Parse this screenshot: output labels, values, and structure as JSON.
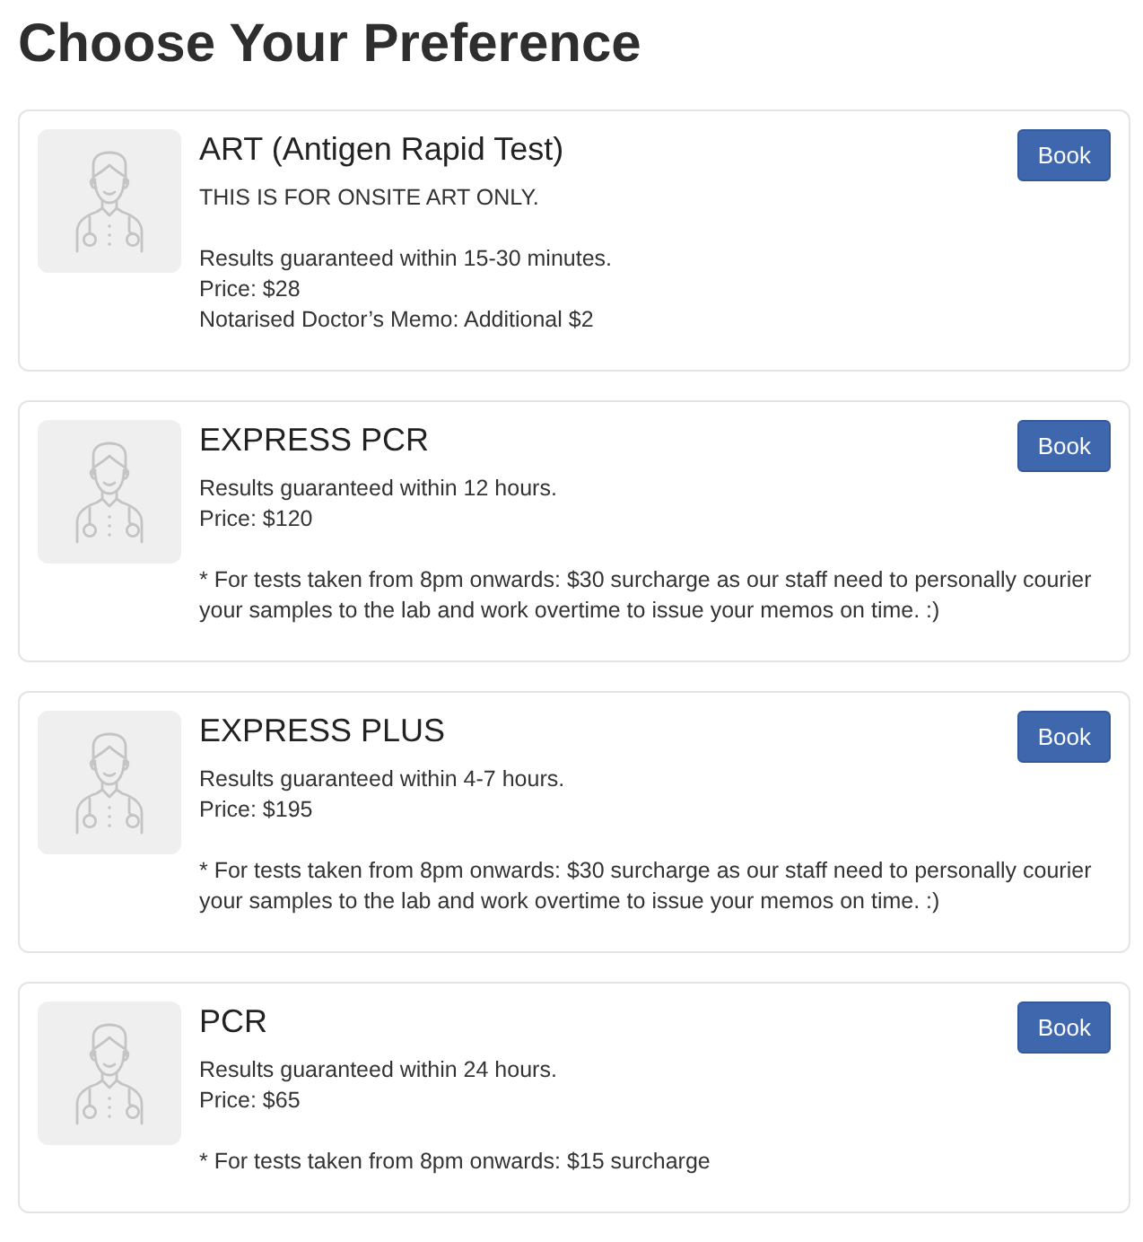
{
  "heading": "Choose Your Preference",
  "options": [
    {
      "name": "ART (Antigen Rapid Test)",
      "button": "Book",
      "paragraphs": [
        [
          "THIS IS FOR ONSITE ART ONLY."
        ],
        [
          "Results guaranteed within 15-30 minutes.",
          "Price: $28",
          "Notarised Doctor’s Memo: Additional $2"
        ]
      ]
    },
    {
      "name": "EXPRESS PCR",
      "button": "Book",
      "paragraphs": [
        [
          "Results guaranteed within 12 hours.",
          "Price: $120"
        ],
        [
          "* For tests taken from 8pm onwards: $30 surcharge as our staff need to personally courier your samples to the lab and work overtime to issue your memos on time. :)"
        ]
      ]
    },
    {
      "name": "EXPRESS PLUS",
      "button": "Book",
      "paragraphs": [
        [
          "Results guaranteed within 4-7 hours.",
          "Price: $195"
        ],
        [
          "* For tests taken from 8pm onwards: $30 surcharge as our staff need to personally courier your samples to the lab and work overtime to issue your memos on time. :)"
        ]
      ]
    },
    {
      "name": "PCR",
      "button": "Book",
      "paragraphs": [
        [
          "Results guaranteed within 24 hours.",
          "Price: $65"
        ],
        [
          "* For tests taken from 8pm onwards: $15 surcharge"
        ]
      ]
    }
  ]
}
